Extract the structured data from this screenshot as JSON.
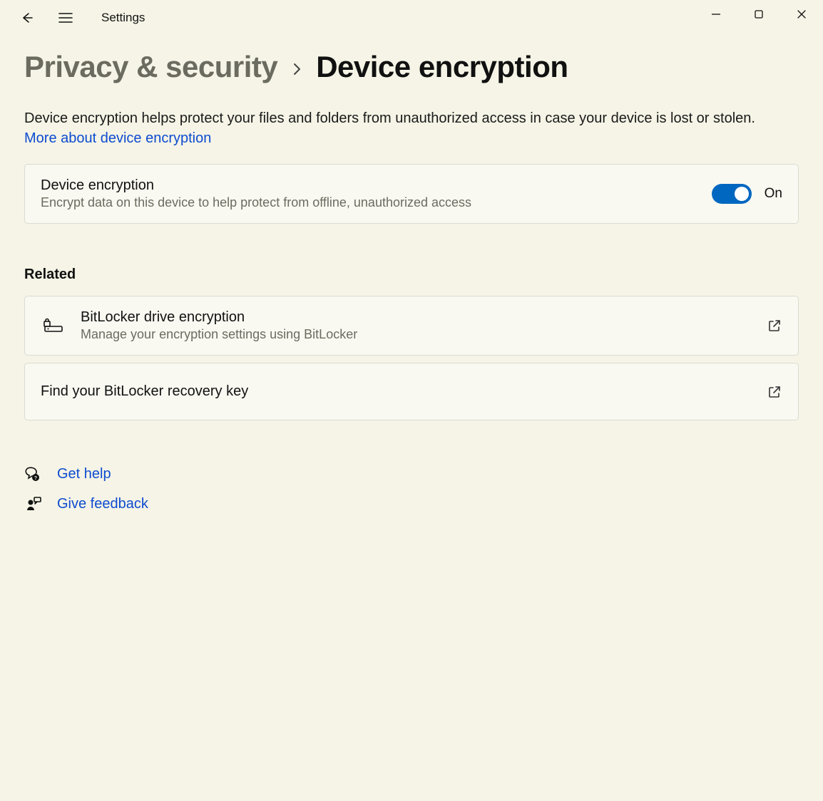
{
  "app": {
    "title": "Settings"
  },
  "breadcrumb": {
    "parent": "Privacy & security",
    "current": "Device encryption"
  },
  "description": {
    "text": "Device encryption helps protect your files and folders from unauthorized access in case your device is lost or stolen. ",
    "link_label": "More about device encryption"
  },
  "encryption_card": {
    "title": "Device encryption",
    "subtitle": "Encrypt data on this device to help protect from offline, unauthorized access",
    "toggle_state_label": "On"
  },
  "related": {
    "header": "Related",
    "bitlocker": {
      "title": "BitLocker drive encryption",
      "subtitle": "Manage your encryption settings using BitLocker"
    },
    "recovery": {
      "title": "Find your BitLocker recovery key"
    }
  },
  "footer": {
    "get_help": "Get help",
    "give_feedback": "Give feedback"
  }
}
